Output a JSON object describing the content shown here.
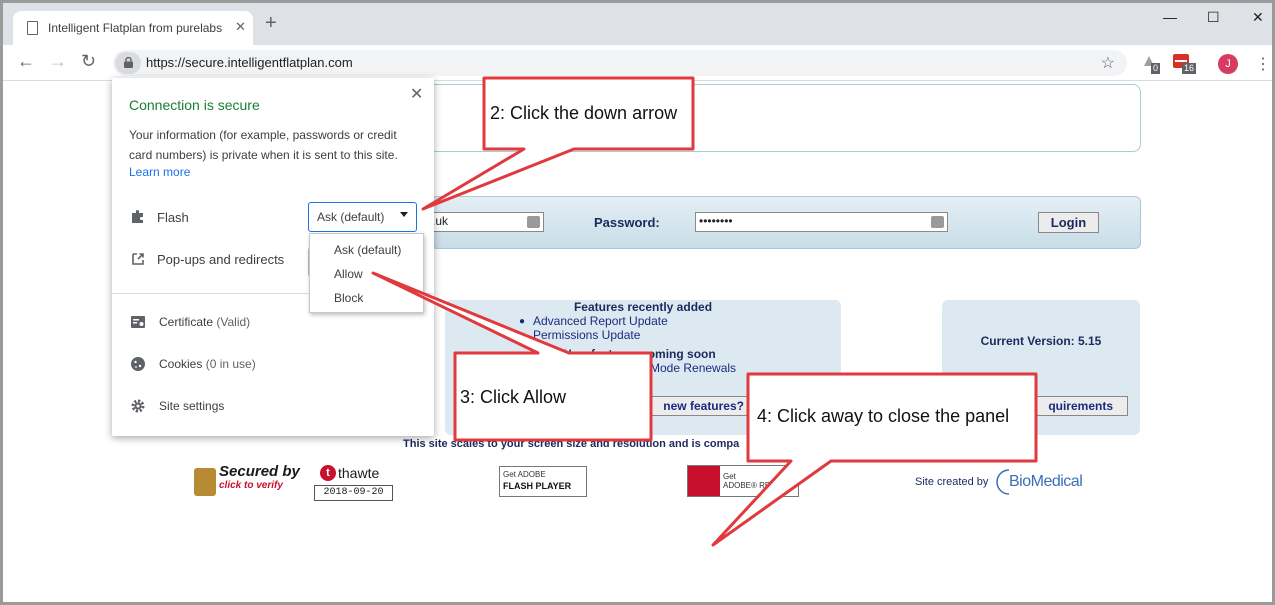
{
  "browser": {
    "tab_title": "Intelligent Flatplan from purelabs",
    "tab_close": "✕",
    "new_tab": "+",
    "window_minimize": "—",
    "window_maximize": "☐",
    "window_close": "✕",
    "back": "←",
    "forward": "→",
    "reload": "↻",
    "url": "https://secure.intelligentflatplan.com",
    "star": "☆",
    "extension_badges": [
      "0",
      "16"
    ],
    "avatar_initial": "J",
    "menu": "⋮"
  },
  "site_popup": {
    "title": "Connection is secure",
    "description": "Your information (for example, passwords or credit card numbers) is private when it is sent to this site.",
    "learn_more": "Learn more",
    "close": "✕",
    "permissions": [
      {
        "label": "Flash",
        "icon": "puzzle-icon",
        "value": "Ask (default)"
      },
      {
        "label": "Pop-ups and redirects",
        "icon": "external-link-icon"
      }
    ],
    "info_items": [
      {
        "label": "Certificate",
        "detail": "(Valid)",
        "icon": "certificate-icon"
      },
      {
        "label": "Cookies",
        "detail": "(0 in use)",
        "icon": "cookie-icon"
      },
      {
        "label": "Site settings",
        "detail": "",
        "icon": "gear-icon"
      }
    ],
    "dropdown_options": [
      "Ask (default)",
      "Allow",
      "Block"
    ]
  },
  "login": {
    "username_value": ".uk",
    "password_label": "Password:",
    "password_value": "••••••••",
    "login_button": "Login"
  },
  "features": {
    "heading": "Features recently added",
    "items": [
      "Advanced Report Update",
      "Permissions Update"
    ],
    "upcoming_partial": "New features coming soon",
    "renewals_partial": "Mode Renewals",
    "new_features_button": "new features?"
  },
  "version": {
    "text": "Current Version: 5.15",
    "requirements_button": "quirements"
  },
  "footer": {
    "scales_text": "This site scales to your screen size and resolution and is compa",
    "thawte_secured": "Secured by",
    "thawte_brand": "thawte",
    "thawte_t": "t",
    "thawte_verify": "click to verify",
    "thawte_date": "2018-09-20",
    "flash_get": "Get ADOBE",
    "flash_name": "FLASH PLAYER",
    "reader_get": "Get",
    "reader_name": "ADOBE® RE",
    "site_created": "Site created by",
    "biomedical": "BioMedical"
  },
  "callouts": [
    {
      "text": "2: Click the down arrow"
    },
    {
      "text": "3: Click Allow"
    },
    {
      "text": "4: Click away to close the panel"
    }
  ],
  "colors": {
    "callout_border": "#e0393e",
    "secure_green": "#188038",
    "link_blue": "#1a73e8",
    "site_navy": "#1a2a5c"
  }
}
